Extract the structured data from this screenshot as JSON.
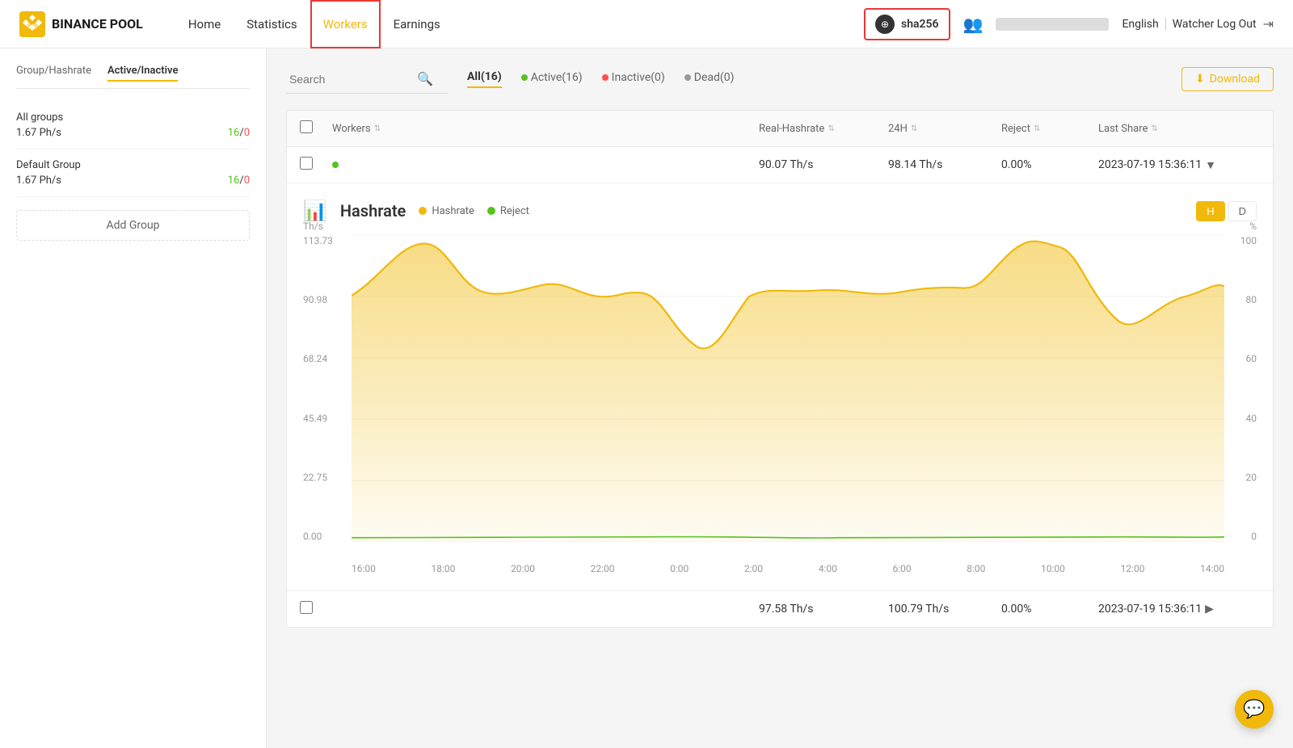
{
  "header": {
    "logo_text": "BINANCE\nPOOL",
    "nav_items": [
      {
        "id": "home",
        "label": "Home",
        "active": false
      },
      {
        "id": "statistics",
        "label": "Statistics",
        "active": false
      },
      {
        "id": "workers",
        "label": "Workers",
        "active": true
      },
      {
        "id": "earnings",
        "label": "Earnings",
        "active": false
      }
    ],
    "account": {
      "icon": "⊕",
      "name": "sha256"
    },
    "language": "English",
    "logout_label": "Watcher Log Out"
  },
  "sidebar": {
    "tab_group": "Group/Hashrate",
    "tab_active": "Active/Inactive",
    "groups": [
      {
        "name": "All groups",
        "hashrate": "1.67 Ph/s",
        "active": "16",
        "inactive": "0"
      },
      {
        "name": "Default Group",
        "hashrate": "1.67 Ph/s",
        "active": "16",
        "inactive": "0"
      }
    ],
    "add_group_label": "Add Group"
  },
  "filter_bar": {
    "search_placeholder": "Search",
    "tabs": [
      {
        "id": "all",
        "label": "All(16)",
        "active": true,
        "dot": "none"
      },
      {
        "id": "active",
        "label": "Active(16)",
        "active": false,
        "dot": "green"
      },
      {
        "id": "inactive",
        "label": "Inactive(0)",
        "active": false,
        "dot": "red"
      },
      {
        "id": "dead",
        "label": "Dead(0)",
        "active": false,
        "dot": "gray"
      }
    ],
    "download_label": "Download"
  },
  "table": {
    "headers": [
      {
        "id": "workers",
        "label": "Workers"
      },
      {
        "id": "real_hashrate",
        "label": "Real-Hashrate"
      },
      {
        "id": "h24",
        "label": "24H"
      },
      {
        "id": "reject",
        "label": "Reject"
      },
      {
        "id": "last_share",
        "label": "Last Share"
      }
    ],
    "row1": {
      "real_hashrate": "90.07 Th/s",
      "h24": "98.14 Th/s",
      "reject": "0.00%",
      "last_share": "2023-07-19 15:36:11"
    },
    "row2": {
      "real_hashrate": "97.58 Th/s",
      "h24": "100.79 Th/s",
      "reject": "0.00%",
      "last_share": "2023-07-19 15:36:11"
    }
  },
  "chart": {
    "title": "Hashrate",
    "legend_hashrate": "Hashrate",
    "legend_reject": "Reject",
    "period_h": "H",
    "period_d": "D",
    "y_labels_left": [
      "113.73",
      "90.98",
      "68.24",
      "45.49",
      "22.75",
      "0.00"
    ],
    "y_labels_right": [
      "100",
      "80",
      "60",
      "40",
      "20",
      "0"
    ],
    "unit_left": "Th/s",
    "unit_right": "%",
    "x_labels": [
      "16:00",
      "18:00",
      "20:00",
      "22:00",
      "0:00",
      "2:00",
      "4:00",
      "6:00",
      "8:00",
      "10:00",
      "12:00",
      "14:00"
    ]
  },
  "chat_fab": {
    "icon": "💬"
  }
}
